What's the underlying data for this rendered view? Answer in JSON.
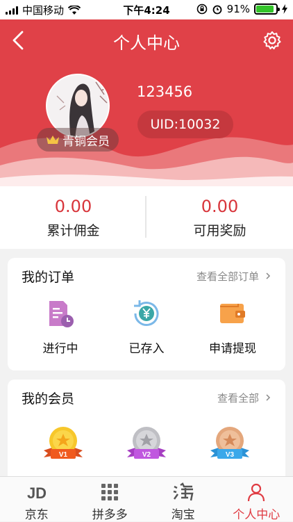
{
  "status_bar": {
    "carrier": "中国移动",
    "time": "下午4:24",
    "battery": "91%"
  },
  "header": {
    "title": "个人中心",
    "username": "123456",
    "uid": "UID:10032",
    "member_level": "青铜会员"
  },
  "stats": [
    {
      "value": "0.00",
      "label": "累计佣金"
    },
    {
      "value": "0.00",
      "label": "可用奖励"
    }
  ],
  "orders": {
    "title": "我的订单",
    "more": "查看全部订单",
    "items": [
      {
        "label": "进行中",
        "icon": "document-clock-icon"
      },
      {
        "label": "已存入",
        "icon": "yuan-deposit-icon"
      },
      {
        "label": "申请提现",
        "icon": "wallet-icon"
      }
    ]
  },
  "members": {
    "title": "我的会员",
    "more": "查看全部",
    "levels": [
      "V1",
      "V2",
      "V3"
    ]
  },
  "tabbar": [
    {
      "label": "京东",
      "icon": "jd-icon"
    },
    {
      "label": "拼多多",
      "icon": "pinduoduo-icon"
    },
    {
      "label": "淘宝",
      "icon": "taobao-icon"
    },
    {
      "label": "个人中心",
      "icon": "person-icon",
      "active": true
    }
  ],
  "colors": {
    "primary": "#e04148",
    "accent_text": "#d8353b"
  }
}
